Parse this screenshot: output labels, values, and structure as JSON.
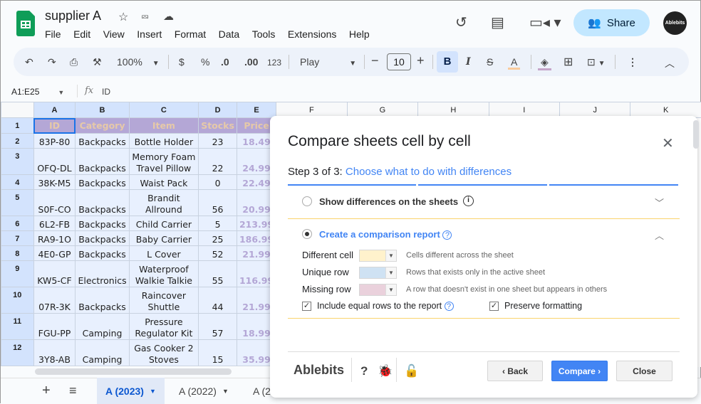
{
  "app": {
    "doc_title": "supplier A",
    "menu": [
      "File",
      "Edit",
      "View",
      "Insert",
      "Format",
      "Data",
      "Tools",
      "Extensions",
      "Help"
    ],
    "share_label": "Share",
    "avatar_label": "Ablebits"
  },
  "toolbar": {
    "zoom": "100%",
    "currency": "$",
    "percent": "%",
    "decrease_decimal": ".0",
    "increase_decimal": ".00",
    "number_format": "123",
    "font": "Play",
    "font_size": "10",
    "bold": "B",
    "italic": "I",
    "text_color": "A"
  },
  "formula_bar": {
    "name_box": "A1:E25",
    "fx": "fx",
    "value": "ID"
  },
  "sheet": {
    "columns": [
      "A",
      "B",
      "C",
      "D",
      "E",
      "F",
      "G",
      "H",
      "I",
      "J",
      "K"
    ],
    "header_row": [
      "ID",
      "Category",
      "Item",
      "Stocks",
      "Price"
    ],
    "rows": [
      {
        "n": "2",
        "id": "83P-80",
        "cat": "Backpacks",
        "item": "Bottle Holder",
        "stock": "23",
        "price": "18.49"
      },
      {
        "n": "3",
        "id": "OFQ-DL",
        "cat": "Backpacks",
        "item": "Memory Foam Travel Pillow",
        "stock": "22",
        "price": "24.99"
      },
      {
        "n": "4",
        "id": "38K-M5",
        "cat": "Backpacks",
        "item": "Waist Pack",
        "stock": "0",
        "price": "22.49"
      },
      {
        "n": "5",
        "id": "S0F-CO",
        "cat": "Backpacks",
        "item": "Brandit Allround",
        "stock": "56",
        "price": "20.99"
      },
      {
        "n": "6",
        "id": "6L2-FB",
        "cat": "Backpacks",
        "item": "Child Carrier",
        "stock": "5",
        "price": "213.99"
      },
      {
        "n": "7",
        "id": "RA9-1O",
        "cat": "Backpacks",
        "item": "Baby Carrier",
        "stock": "25",
        "price": "186.99"
      },
      {
        "n": "8",
        "id": "4E0-GP",
        "cat": "Backpacks",
        "item": "L Cover",
        "stock": "52",
        "price": "21.99"
      },
      {
        "n": "9",
        "id": "KW5-CF",
        "cat": "Electronics",
        "item": "Waterproof Walkie Talkie",
        "stock": "55",
        "price": "116.99"
      },
      {
        "n": "10",
        "id": "07R-3K",
        "cat": "Backpacks",
        "item": "Raincover Shuttle",
        "stock": "44",
        "price": "21.99"
      },
      {
        "n": "11",
        "id": "FGU-PP",
        "cat": "Camping",
        "item": "Pressure Regulator Kit",
        "stock": "57",
        "price": "18.99"
      },
      {
        "n": "12",
        "id": "3Y8-AB",
        "cat": "Camping",
        "item": "Gas Cooker 2 Stoves",
        "stock": "15",
        "price": "35.99"
      }
    ]
  },
  "tabs": [
    {
      "label": "A (2023)",
      "active": true
    },
    {
      "label": "A (2022)",
      "active": false
    },
    {
      "label": "A (2",
      "active": false
    }
  ],
  "dialog": {
    "title": "Compare sheets cell by cell",
    "step_prefix": "Step 3 of 3:",
    "step_text": "Choose what to do with differences",
    "option1": "Show differences on the sheets",
    "option2": "Create a comparison report",
    "colors": [
      {
        "label": "Different cell",
        "color": "#fff2cc",
        "desc": "Cells different across the sheet"
      },
      {
        "label": "Unique row",
        "color": "#cfe2f3",
        "desc": "Rows that exists only in the active sheet"
      },
      {
        "label": "Missing row",
        "color": "#ead1dc",
        "desc": "A row that doesn't exist in one sheet but appears in others"
      }
    ],
    "include_equal": "Include equal rows to the report",
    "preserve_formatting": "Preserve formatting",
    "brand": "Ablebits",
    "back": "‹ Back",
    "compare": "Compare ›",
    "close": "Close"
  },
  "colors": {
    "accent": "#4285f4",
    "share_bg": "#c2e7ff",
    "header_fill": "#b4a7d6",
    "selection": "#e8f0fe"
  }
}
